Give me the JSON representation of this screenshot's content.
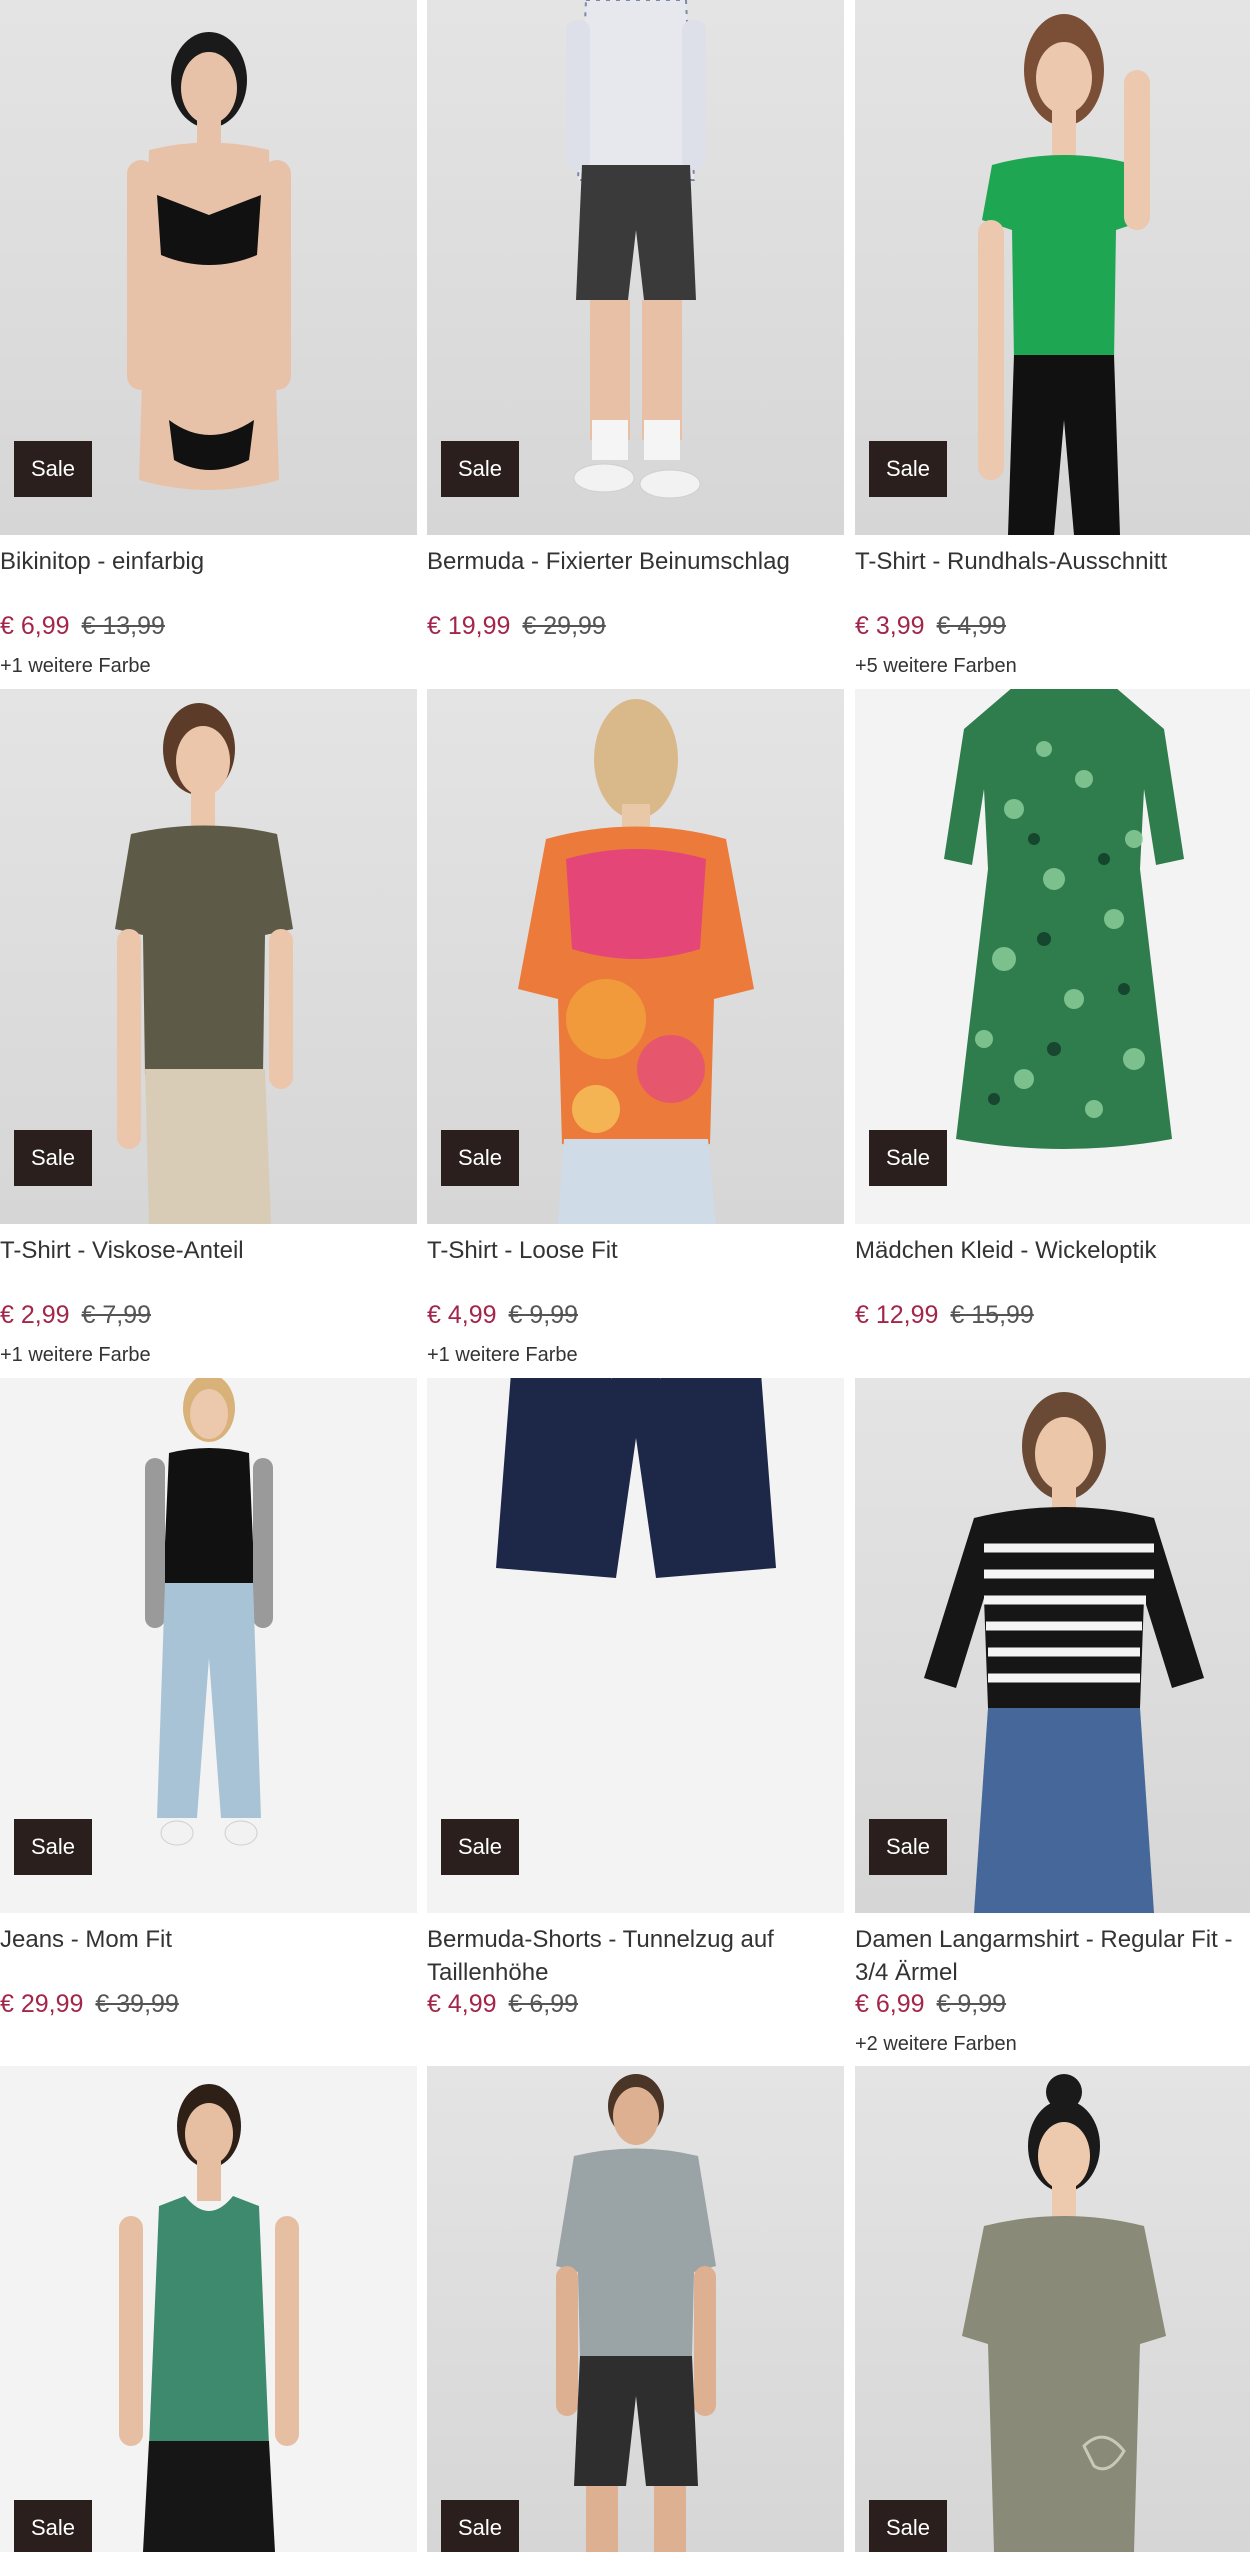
{
  "products": [
    {
      "title": "Bikinitop - einfarbig",
      "badge": "Sale",
      "price": "€ 6,99",
      "old_price": "€ 13,99",
      "colors": "+1 weitere Farbe",
      "color": "#111111",
      "skin": "#e8c2a8"
    },
    {
      "title": "Bermuda - Fixierter Beinumschlag",
      "badge": "Sale",
      "price": "€ 19,99",
      "old_price": "€ 29,99",
      "colors": "",
      "color": "#3a3a3a",
      "skin": "#e7c0a6"
    },
    {
      "title": "T-Shirt - Rundhals-Ausschnitt",
      "badge": "Sale",
      "price": "€ 3,99",
      "old_price": "€ 4,99",
      "colors": "+5 weitere Farben",
      "color": "#1fa653",
      "skin": "#ecc8ae"
    },
    {
      "title": "T-Shirt - Viskose-Anteil",
      "badge": "Sale",
      "price": "€ 2,99",
      "old_price": "€ 7,99",
      "colors": "+1 weitere Farbe",
      "color": "#5e5a48",
      "skin": "#ebc6ab"
    },
    {
      "title": "T-Shirt - Loose Fit",
      "badge": "Sale",
      "price": "€ 4,99",
      "old_price": "€ 9,99",
      "colors": "+1 weitere Farbe",
      "color": "#ec7a3a",
      "skin": "#e9c8a8"
    },
    {
      "title": "Mädchen Kleid - Wickeloptik",
      "badge": "Sale",
      "price": "€ 12,99",
      "old_price": "€ 15,99",
      "colors": "",
      "color": "#2f7d4d",
      "skin": ""
    },
    {
      "title": "Jeans - Mom Fit",
      "badge": "Sale",
      "price": "€ 29,99",
      "old_price": "€ 39,99",
      "colors": "",
      "color": "#a9c3d6",
      "skin": "#ecc8ad"
    },
    {
      "title": "Bermuda-Shorts - Tunnelzug auf Taillenhöhe",
      "badge": "Sale",
      "price": "€ 4,99",
      "old_price": "€ 6,99",
      "colors": "",
      "color": "#1d2748",
      "skin": ""
    },
    {
      "title": "Damen Langarmshirt - Regular Fit - 3/4 Ärmel",
      "badge": "Sale",
      "price": "€ 6,99",
      "old_price": "€ 9,99",
      "colors": "+2 weitere Farben",
      "color": "#161616",
      "skin": "#ecc6a9"
    },
    {
      "title": "",
      "badge": "Sale",
      "price": "",
      "old_price": "",
      "colors": "",
      "color": "#3d8a6e",
      "skin": "#e6bfa2"
    },
    {
      "title": "",
      "badge": "Sale",
      "price": "",
      "old_price": "",
      "colors": "",
      "color": "#9aa3a6",
      "skin": "#dcb090"
    },
    {
      "title": "",
      "badge": "Sale",
      "price": "",
      "old_price": "",
      "colors": "",
      "color": "#8a8a78",
      "skin": "#edc9ad"
    }
  ]
}
